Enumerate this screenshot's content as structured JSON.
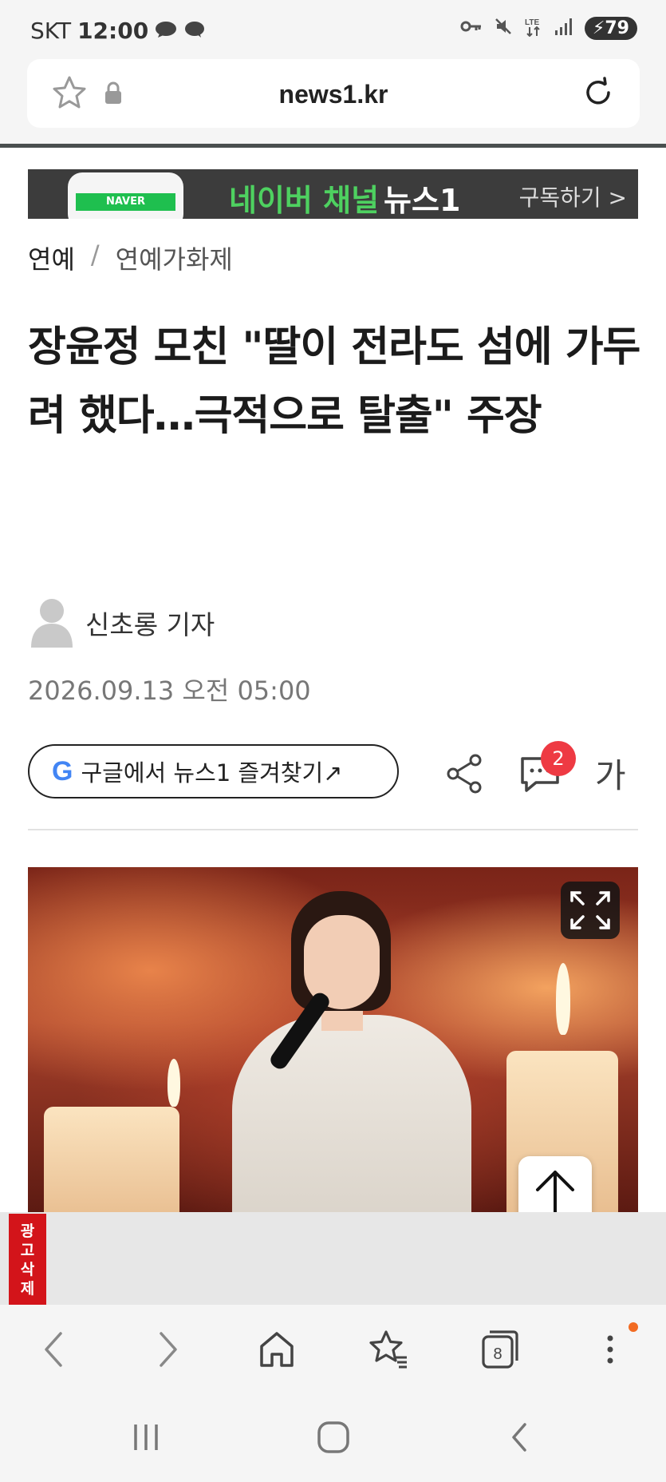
{
  "status_bar": {
    "carrier": "SKT",
    "time": "12:00",
    "battery": "79"
  },
  "browser": {
    "url": "news1.kr"
  },
  "banner": {
    "phone_label": "NAVER",
    "text": "네이버 채널",
    "brand": "뉴스1",
    "subscribe": "구독하기 >"
  },
  "breadcrumb": {
    "section": "연예",
    "separator": "/",
    "subsection": "연예가화제"
  },
  "article": {
    "headline": "장윤정 모친 \"딸이 전라도 섬에 가두려 했다…극적으로 탈출\" 주장",
    "author": "신초롱 기자",
    "datetime": "2026.09.13 오전 05:00"
  },
  "actions": {
    "google_g": "G",
    "google_favorite": "구글에서 뉴스1 즐겨찾기↗",
    "comment_count": "2",
    "font_size_label": "가"
  },
  "ad": {
    "close_label": "광고삭제"
  },
  "browser_nav": {
    "tab_count": "8"
  },
  "icons": {
    "star": "star-icon",
    "lock": "lock-icon",
    "reload": "reload-icon",
    "share": "share-icon",
    "comment": "comment-icon",
    "expand": "expand-icon",
    "back": "back-icon",
    "forward": "forward-icon",
    "home": "home-icon",
    "bookmarks": "bookmarks-icon",
    "tabs": "tabs-icon",
    "menu": "more-icon"
  },
  "colors": {
    "accent_badge": "#ee3a43",
    "banner_green": "#4ed160",
    "ad_red": "#d3141a",
    "notification_dot": "#f26b22"
  }
}
